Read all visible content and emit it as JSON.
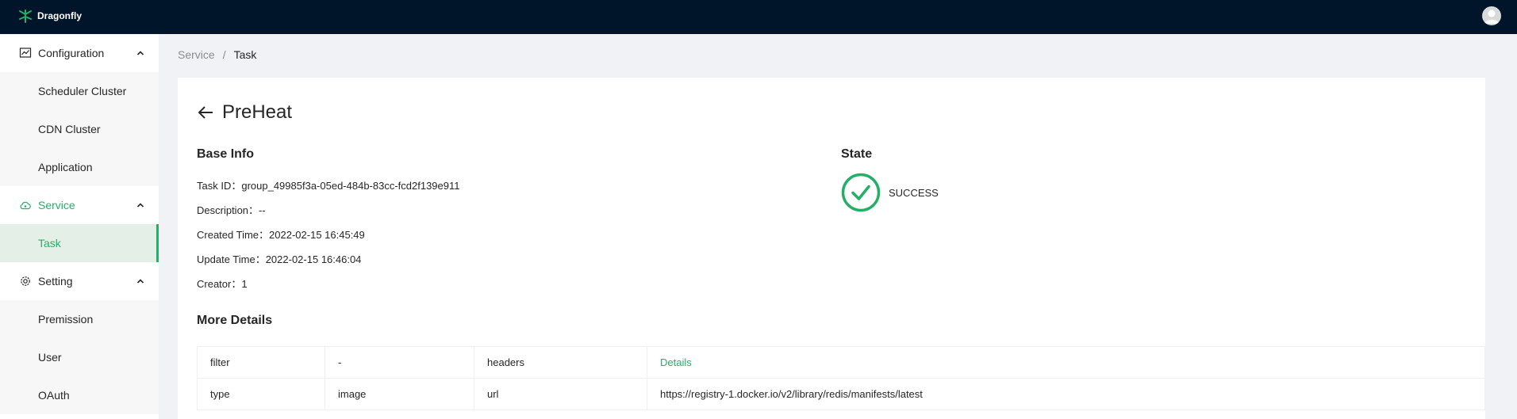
{
  "brand": {
    "name": "Dragonfly",
    "logo_icon": "dragonfly-logo-icon"
  },
  "colors": {
    "accent": "#23B066",
    "topbar": "#001529"
  },
  "sidebar": {
    "groups": [
      {
        "label": "Configuration",
        "icon": "chart-line-icon",
        "items": [
          "Scheduler Cluster",
          "CDN Cluster",
          "Application"
        ]
      },
      {
        "label": "Service",
        "icon": "cloud-icon",
        "items": [
          "Task"
        ]
      },
      {
        "label": "Setting",
        "icon": "gear-icon",
        "items": [
          "Premission",
          "User",
          "OAuth"
        ]
      }
    ],
    "active_group": "Service",
    "selected_item": "Task"
  },
  "breadcrumb": {
    "parent": "Service",
    "separator": "/",
    "current": "Task"
  },
  "page": {
    "title": "PreHeat"
  },
  "base_info": {
    "title": "Base Info",
    "rows": [
      {
        "label": "Task ID：",
        "value": "group_49985f3a-05ed-484b-83cc-fcd2f139e911"
      },
      {
        "label": "Description：",
        "value": "--"
      },
      {
        "label": "Created Time：",
        "value": "2022-02-15 16:45:49"
      },
      {
        "label": "Update Time：",
        "value": "2022-02-15 16:46:04"
      },
      {
        "label": "Creator：",
        "value": "1"
      }
    ]
  },
  "state": {
    "title": "State",
    "value": "SUCCESS",
    "icon": "check-circle-icon"
  },
  "more_details": {
    "title": "More Details",
    "rows": [
      [
        "filter",
        "-",
        "headers",
        "Details"
      ],
      [
        "type",
        "image",
        "url",
        "https://registry-1.docker.io/v2/library/redis/manifests/latest"
      ]
    ]
  }
}
